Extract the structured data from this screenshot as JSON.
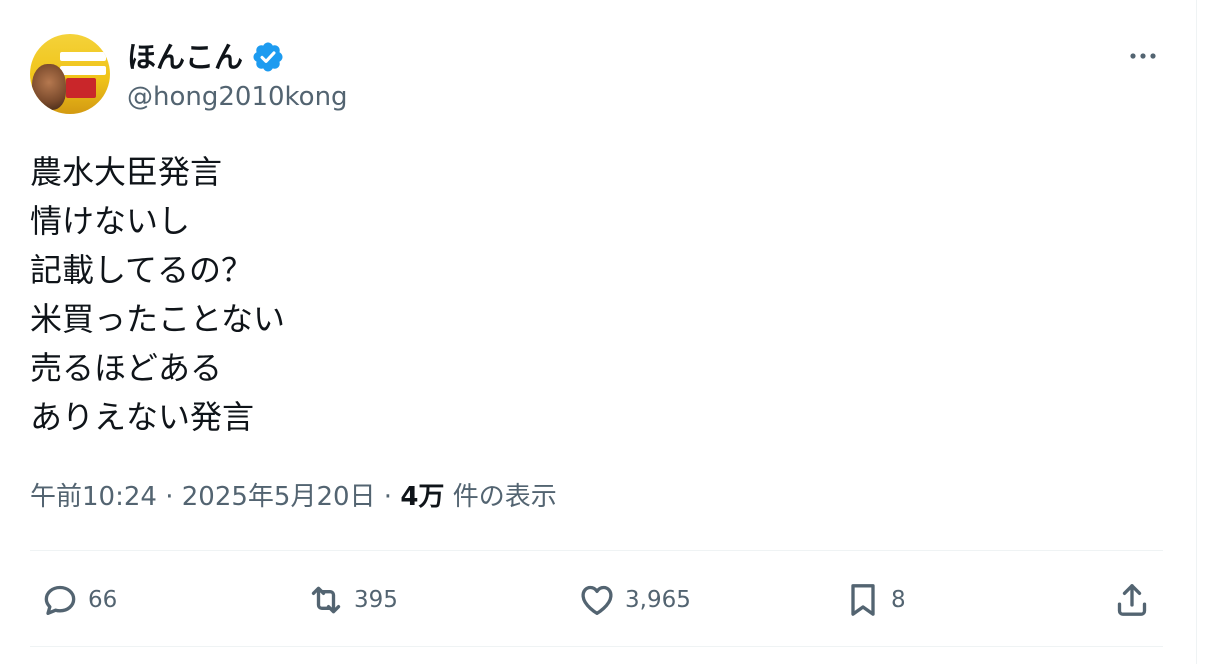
{
  "author": {
    "display_name": "ほんこん",
    "handle": "@hong2010kong",
    "verified": true
  },
  "tweet": {
    "lines": [
      "農水大臣発言",
      "情けないし",
      "記載してるの？",
      "米買ったことない",
      "売るほどある",
      "ありえない発言"
    ]
  },
  "meta": {
    "time": "午前10:24",
    "separator": "·",
    "date": "2025年5月20日",
    "views_count": "4万",
    "views_label": "件の表示"
  },
  "actions": {
    "replies": "66",
    "retweets": "395",
    "likes": "3,965",
    "bookmarks": "8"
  },
  "icons": {
    "verified": "verified-badge-icon",
    "more": "more-horizontal-icon",
    "reply": "reply-icon",
    "retweet": "retweet-icon",
    "like": "heart-icon",
    "bookmark": "bookmark-icon",
    "share": "share-icon"
  },
  "colors": {
    "text": "#0f1419",
    "secondary": "#536471",
    "verified": "#1d9bf0",
    "divider": "#eff3f4"
  }
}
